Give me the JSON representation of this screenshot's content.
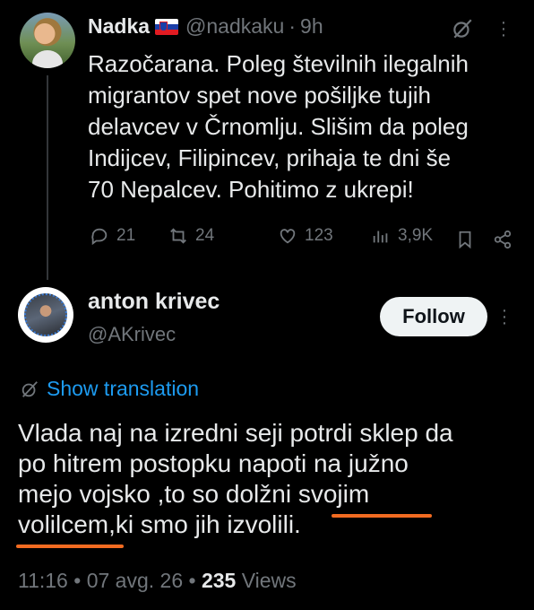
{
  "tweet1": {
    "author_name": "Nadka",
    "flag": "slovenia-flag",
    "handle": "@nadkaku",
    "separator": "·",
    "time": "9h",
    "text": "Razočarana. Poleg številnih ilegalnih\nmigrantov spet nove pošiljke tujih\ndelavcev v Črnomlju. Slišim da poleg\nIndijcev, Filipincev, prihaja  te dni še\n70 Nepalcev. Pohitimo z ukrepi!",
    "replies": "21",
    "reposts": "24",
    "likes": "123",
    "views": "3,9K"
  },
  "tweet2": {
    "author_name": "anton krivec",
    "handle": "@AKrivec",
    "follow_label": "Follow",
    "show_translation": "Show translation",
    "text": "Vlada naj na izredni seji potrdi sklep da\npo hitrem postopku napoti na južno\nmejo vojsko ,to so dolžni svojim\nvolilcem,ki smo jih izvolili.",
    "time": "11:16",
    "date": "07 avg. 26",
    "views_count": "235",
    "views_label": "Views",
    "dot": "•"
  },
  "colors": {
    "background": "#000000",
    "text": "#e7e9ea",
    "muted": "#71767b",
    "link": "#1d9bf0",
    "annotation_underline": "#f26b21"
  }
}
